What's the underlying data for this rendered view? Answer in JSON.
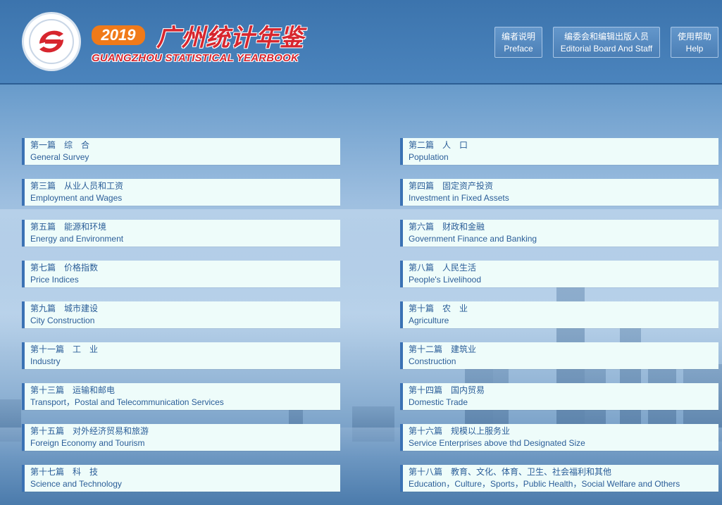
{
  "header": {
    "year": "2019",
    "title_cn": "广州统计年鉴",
    "title_en": "GUANGZHOU STATISTICAL YEARBOOK",
    "buttons": [
      {
        "cn": "编者说明",
        "en": "Preface"
      },
      {
        "cn": "编委会和编辑出版人员",
        "en": "Editorial Board And Staff"
      },
      {
        "cn": "使用帮助",
        "en": "Help"
      }
    ]
  },
  "sections": [
    {
      "cn": "第一篇　综　合",
      "en": "General Survey"
    },
    {
      "cn": "第二篇　人　口",
      "en": "Population"
    },
    {
      "cn": "第三篇　从业人员和工资",
      "en": "Employment and Wages"
    },
    {
      "cn": "第四篇　固定资产投资",
      "en": "Investment in Fixed Assets"
    },
    {
      "cn": "第五篇　能源和环境",
      "en": "Energy and Environment"
    },
    {
      "cn": "第六篇　财政和金融",
      "en": "Government Finance and Banking"
    },
    {
      "cn": "第七篇　价格指数",
      "en": "Price Indices"
    },
    {
      "cn": "第八篇　人民生活",
      "en": "People's Livelihood"
    },
    {
      "cn": "第九篇　城市建设",
      "en": "City Construction"
    },
    {
      "cn": "第十篇　农　业",
      "en": "Agriculture"
    },
    {
      "cn": "第十一篇　工　业",
      "en": "Industry"
    },
    {
      "cn": "第十二篇　建筑业",
      "en": "Construction"
    },
    {
      "cn": "第十三篇　运输和邮电",
      "en": "Transport，Postal and Telecommunication Services"
    },
    {
      "cn": "第十四篇　国内贸易",
      "en": "Domestic Trade"
    },
    {
      "cn": "第十五篇　对外经济贸易和旅游",
      "en": "Foreign Economy and Tourism"
    },
    {
      "cn": "第十六篇　规模以上服务业",
      "en": "Service Enterprises above thd Designated Size"
    },
    {
      "cn": "第十七篇　科　技",
      "en": "Science and Technology"
    },
    {
      "cn": "第十八篇　教育、文化、体育、卫生、社会福利和其他",
      "en": "Education，Culture，Sports，Public Health，Social Welfare and Others"
    }
  ],
  "colors": {
    "header_bg": "#3c74ad",
    "accent_red": "#d7262e",
    "badge_orange": "#f07a1a",
    "section_bg": "#eefcfa",
    "section_text": "#2a5d98"
  },
  "icons": {
    "logo": "statistics-logo-icon"
  }
}
